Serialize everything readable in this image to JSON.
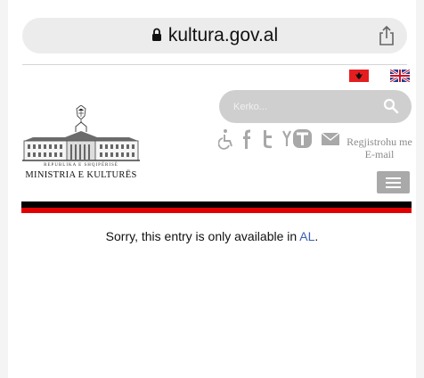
{
  "browser": {
    "url": "kultura.gov.al",
    "lock_icon": "lock-icon",
    "share_icon": "share-icon"
  },
  "header": {
    "languages": [
      {
        "code": "sq",
        "icon": "albania-flag-icon"
      },
      {
        "code": "en",
        "icon": "uk-flag-icon"
      }
    ],
    "search": {
      "placeholder": "Kerko...",
      "value": "",
      "icon": "search-icon"
    },
    "social_icons": [
      "accessibility-icon",
      "facebook-icon",
      "twitter-icon",
      "youtube-icon",
      "mail-icon"
    ],
    "register_label": "Regjistrohu me E-mail",
    "menu_icon": "hamburger-menu-icon"
  },
  "logo": {
    "subtitle": "REPUBLIKA E SHQIPËRISË",
    "title": "MINISTRIA E KULTURËS"
  },
  "content": {
    "message": "Sorry, this entry is only available in",
    "link": "AL",
    "period": "."
  },
  "colors": {
    "accent_red": "#e10000",
    "link_blue": "#3a5fb4",
    "search_bg": "#cfcfcf",
    "menu_bg": "#a9a9a9"
  }
}
